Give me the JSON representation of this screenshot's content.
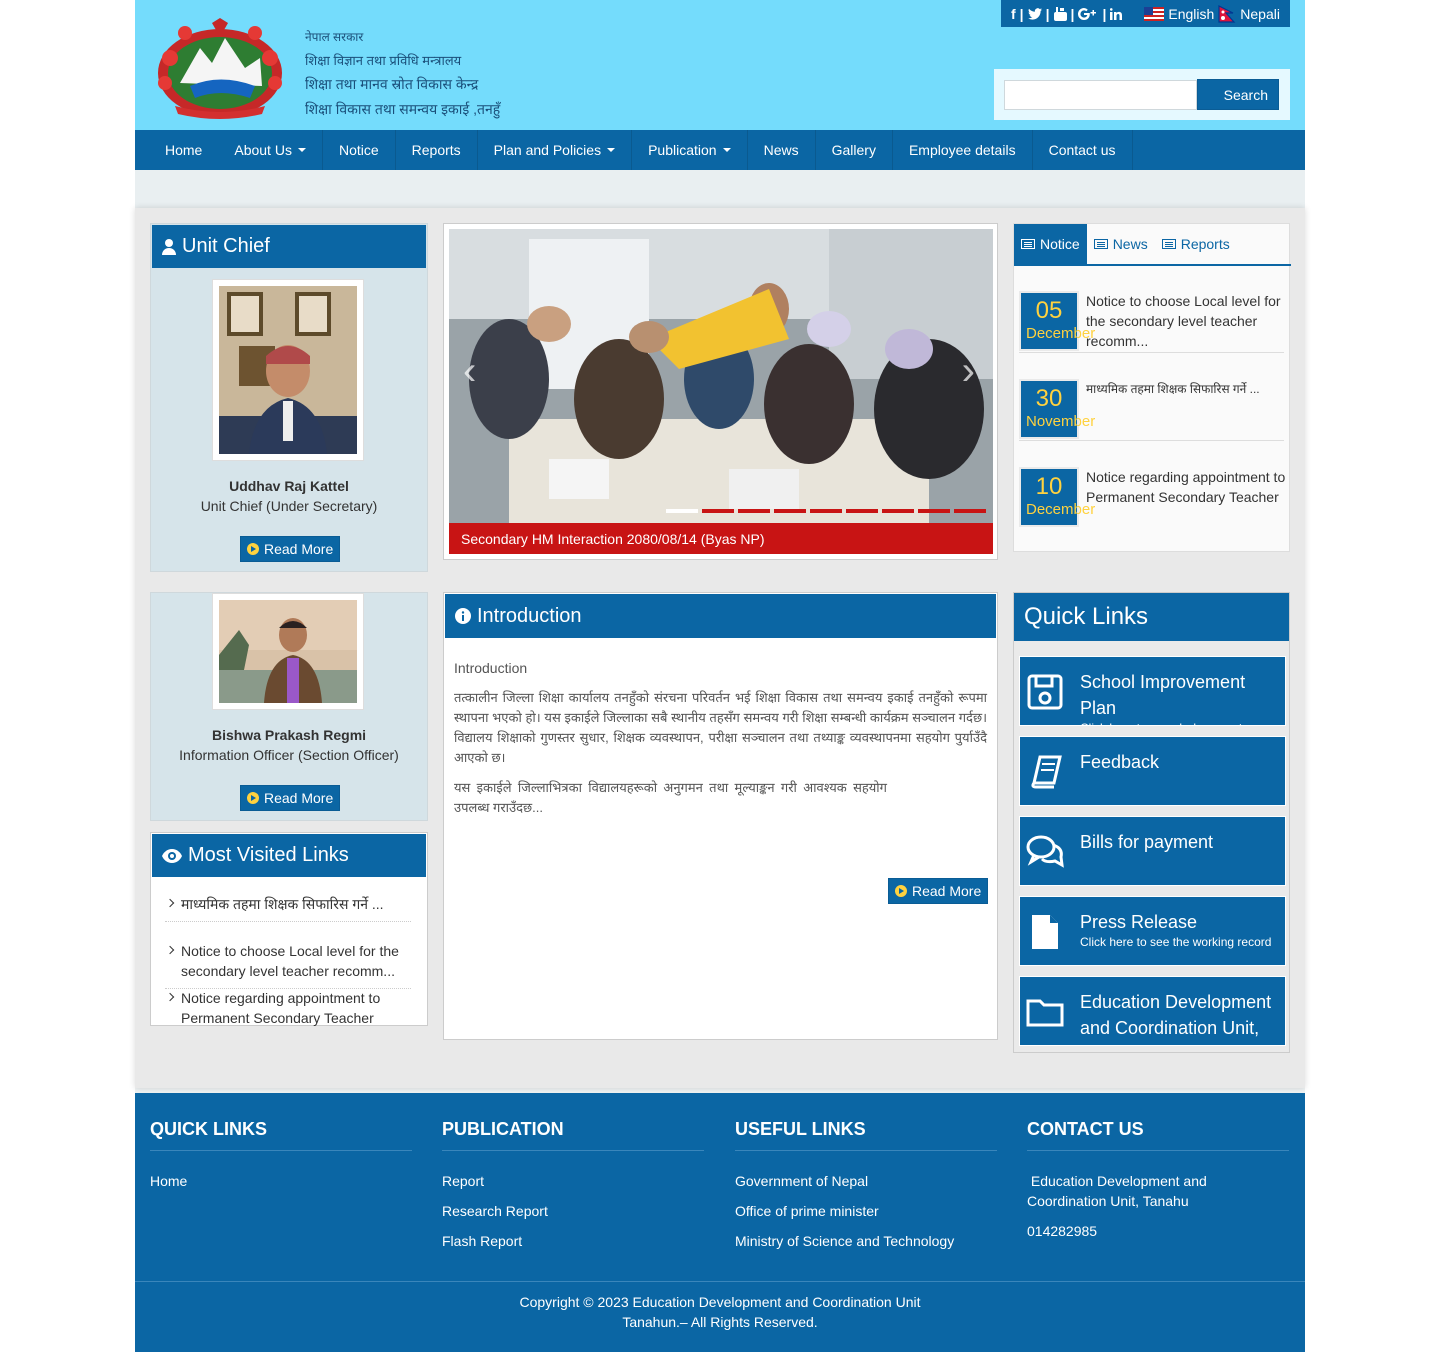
{
  "header": {
    "org_line1": "नेपाल सरकार",
    "org_line2": "शिक्षा विज्ञान तथा प्रविधि मन्त्रालय",
    "org_line3": "शिक्षा तथा मानव स्रोत विकास केन्द्र",
    "org_line4": "शिक्षा विकास तथा समन्वय इकाई ,तनहुँ",
    "social_separator": "|",
    "lang_english": "English",
    "lang_nepali": "Nepali",
    "search_placeholder": "",
    "search_button": "Search"
  },
  "nav": [
    {
      "label": "Home",
      "dropdown": false
    },
    {
      "label": "About Us",
      "dropdown": true
    },
    {
      "label": "Notice",
      "dropdown": false
    },
    {
      "label": "Reports",
      "dropdown": false
    },
    {
      "label": "Plan and Policies",
      "dropdown": true
    },
    {
      "label": "Publication",
      "dropdown": true
    },
    {
      "label": "News",
      "dropdown": false
    },
    {
      "label": "Gallery",
      "dropdown": false
    },
    {
      "label": "Employee details",
      "dropdown": false
    },
    {
      "label": "Contact us",
      "dropdown": false
    }
  ],
  "unit_chief": {
    "title": "Unit Chief",
    "name": "Uddhav Raj Kattel",
    "role": "Unit Chief (Under Secretary)",
    "read_more": "Read More"
  },
  "info_officer": {
    "name": "Bishwa Prakash Regmi",
    "role": "Information Officer (Section Officer)",
    "read_more": "Read More"
  },
  "slider": {
    "caption": "Secondary HM Interaction 2080/08/14 (Byas NP)",
    "slide_count": 9,
    "active_index": 0,
    "prev": "‹",
    "next": "›"
  },
  "tabs": {
    "items": [
      "Notice",
      "News",
      "Reports"
    ],
    "active": "Notice",
    "notices": [
      {
        "day": "05",
        "month": "December",
        "text": "Notice to choose Local level for the secondary level teacher recomm..."
      },
      {
        "day": "30",
        "month": "November",
        "text": "माध्यमिक तहमा शिक्षक सिफारिस गर्ने ..."
      },
      {
        "day": "10",
        "month": "December",
        "text": "Notice regarding appointment to Permanent Secondary Teacher"
      }
    ]
  },
  "introduction": {
    "title": "Introduction",
    "subtitle": "Introduction",
    "para1": "तत्कालीन जिल्ला शिक्षा कार्यालय तनहुँको संरचना परिवर्तन भई शिक्षा विकास तथा समन्वय इकाई तनहुँको रूपमा स्थापना भएको हो। यस इकाईले जिल्लाका सबै स्थानीय तहसँग समन्वय गरी शिक्षा सम्बन्धी कार्यक्रम सञ्चालन गर्दछ। विद्यालय शिक्षाको गुणस्तर सुधार, शिक्षक व्यवस्थापन, परीक्षा सञ्चालन तथा तथ्याङ्क व्यवस्थापनमा सहयोग पुर्याउँदै आएको छ।",
    "para2": "यस इकाईले जिल्लाभित्रका विद्यालयहरूको अनुगमन तथा मूल्याङ्कन गरी आवश्यक सहयोग उपलब्ध गराउँदछ...",
    "read_more": "Read More"
  },
  "quick_links": {
    "title": "Quick Links",
    "items": [
      {
        "icon": "floppy-icon",
        "title": "School Improvement Plan",
        "sub": "Click here to search documents"
      },
      {
        "icon": "book-icon",
        "title": "Feedback",
        "sub": ""
      },
      {
        "icon": "chat-icon",
        "title": "Bills for payment",
        "sub": ""
      },
      {
        "icon": "file-icon",
        "title": "Press Release",
        "sub": "Click here to see the working record"
      },
      {
        "icon": "folder-icon",
        "title": "Education Development and Coordination Unit, Tanahu",
        "sub": ""
      }
    ]
  },
  "most_visited": {
    "title": "Most Visited Links",
    "items": [
      "माध्यमिक तहमा शिक्षक सिफारिस गर्ने ...",
      "Notice to choose Local level for the secondary level teacher recomm...",
      "Notice regarding appointment to Permanent Secondary Teacher"
    ]
  },
  "footer": {
    "quick_links_title": "Quick Links",
    "quick_links": [
      "Home"
    ],
    "publication_title": "Publication",
    "publication": [
      "Report",
      "Research Report",
      "Flash Report"
    ],
    "useful_title": "Useful Links",
    "useful": [
      "Government of Nepal",
      "Office of prime minister",
      "Ministry of Science and Technology"
    ],
    "contact_title": "Contact us",
    "contact_org": " Education Development and Coordination Unit, Tanahu",
    "contact_phone": "014282985",
    "copyright_line1": "Copyright © 2023 Education Development and Coordination Unit",
    "copyright_line2": "Tanahun.– All Rights Reserved."
  },
  "colors": {
    "primary": "#0b66a4",
    "header_bg": "#74dcfc",
    "caption_red": "#c81414",
    "date_yellow": "#ffd23f"
  }
}
